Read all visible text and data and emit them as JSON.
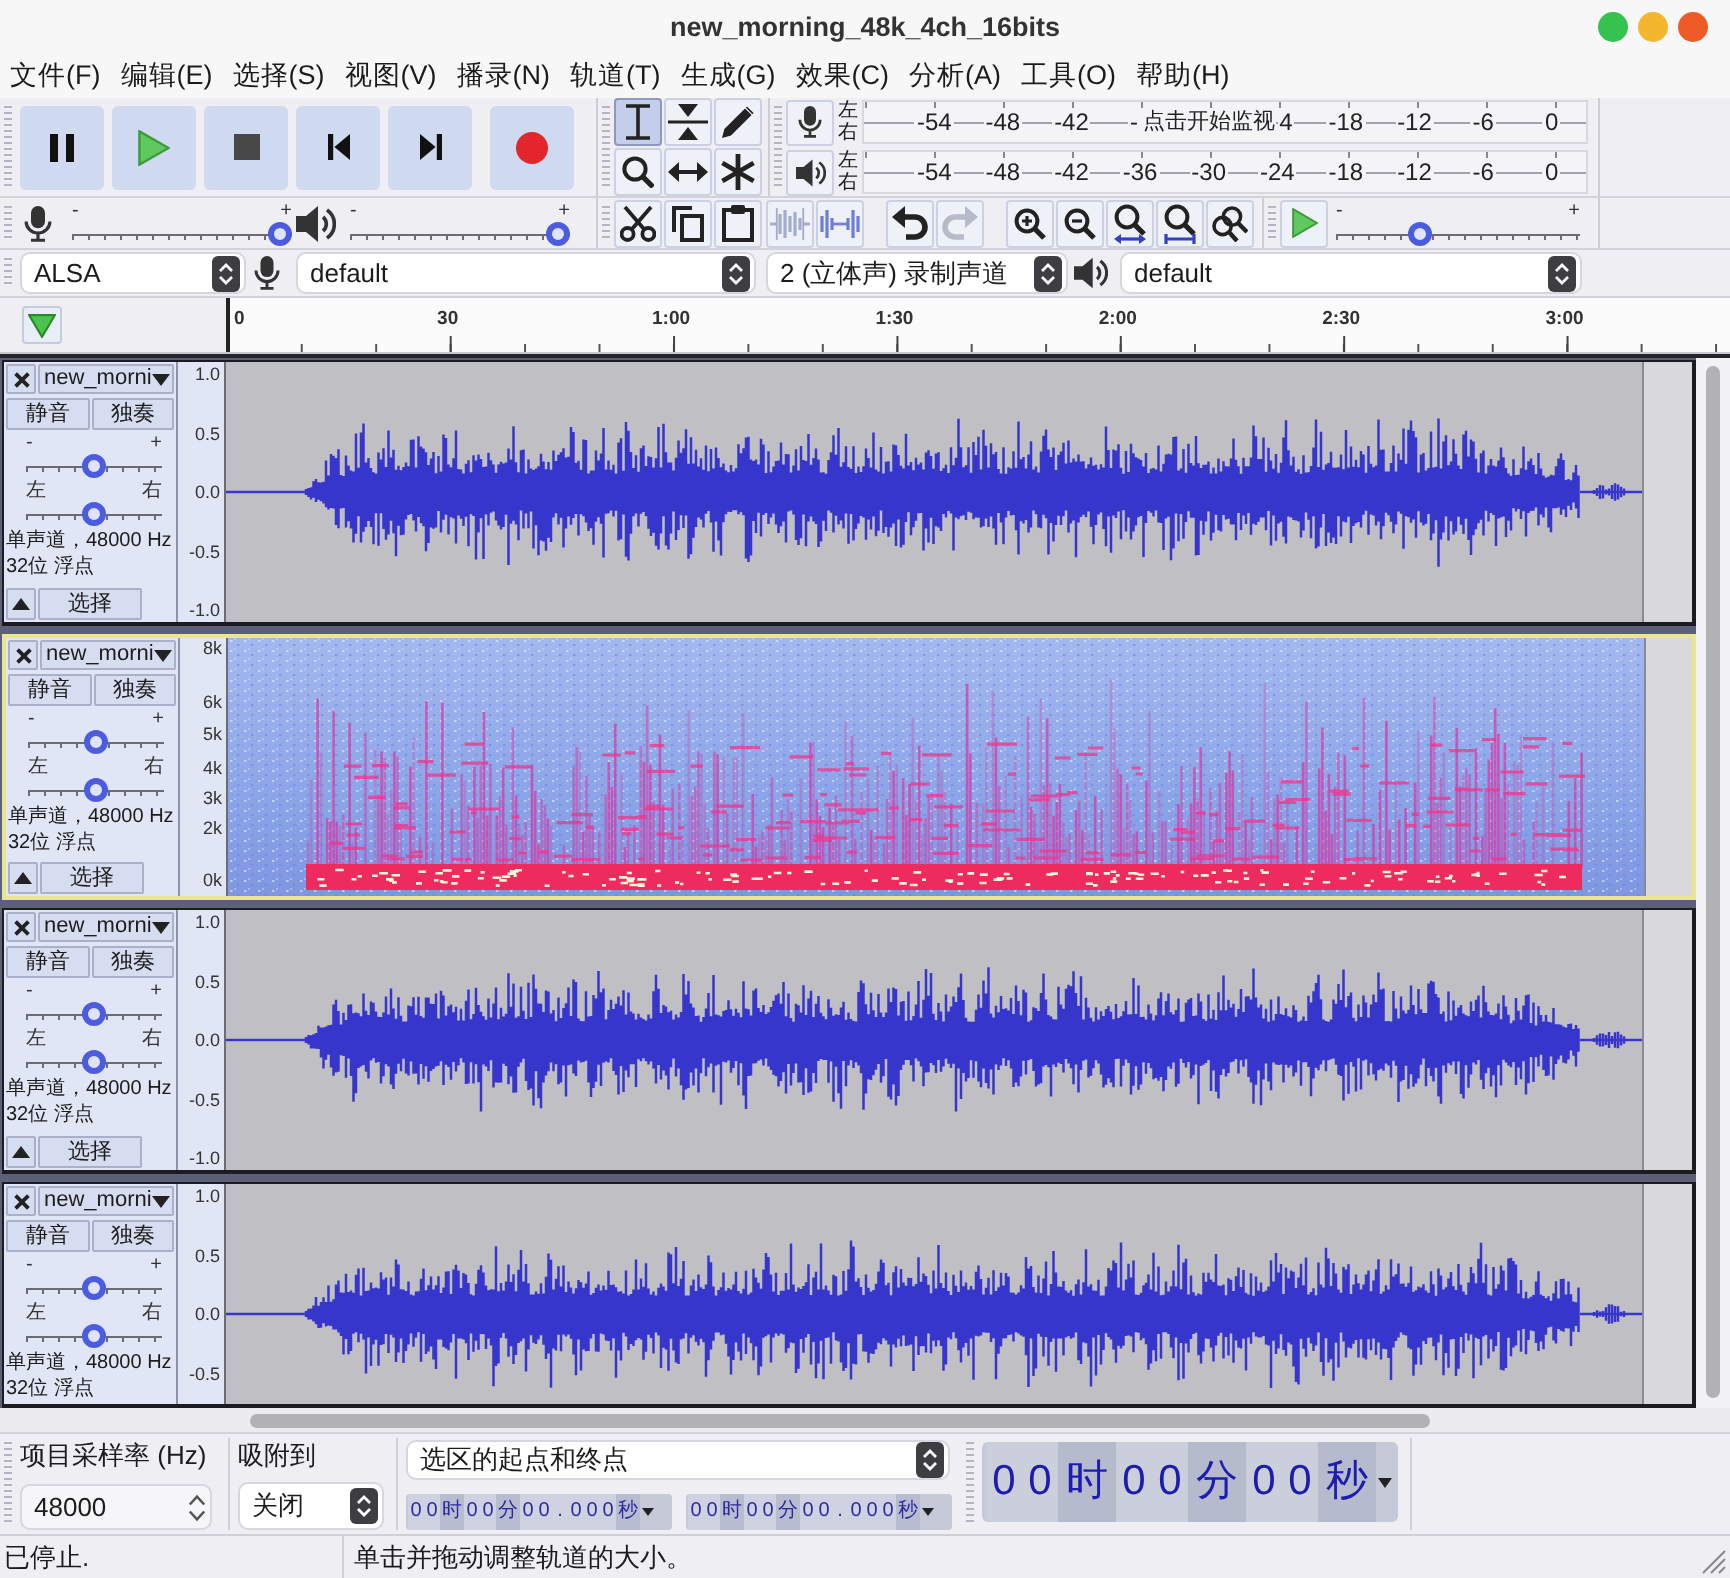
{
  "window": {
    "title": "new_morning_48k_4ch_16bits"
  },
  "menu": [
    "文件(F)",
    "编辑(E)",
    "选择(S)",
    "视图(V)",
    "播录(N)",
    "轨道(T)",
    "生成(G)",
    "效果(C)",
    "分析(A)",
    "工具(O)",
    "帮助(H)"
  ],
  "tools": [
    {
      "selected": true
    },
    {
      "selected": false
    },
    {
      "selected": false
    },
    {
      "selected": false
    },
    {
      "selected": false
    },
    {
      "selected": false
    }
  ],
  "meters": [
    {
      "kind": "recording",
      "channels": [
        "左",
        "右"
      ],
      "scale": [
        {
          "kind": "tick",
          "text": "-54"
        },
        {
          "kind": "tick",
          "text": "-48"
        },
        {
          "kind": "tick",
          "text": "-42"
        },
        {
          "kind": "tick",
          "text": "-"
        },
        {
          "kind": "hint",
          "text": "点击开始监视"
        },
        {
          "kind": "tick",
          "text": "4"
        },
        {
          "kind": "tick",
          "text": "-18"
        },
        {
          "kind": "tick",
          "text": "-12"
        },
        {
          "kind": "tick",
          "text": "-6"
        },
        {
          "kind": "tick",
          "text": "0"
        }
      ]
    },
    {
      "kind": "playback",
      "channels": [
        "左",
        "右"
      ],
      "scale": [
        {
          "kind": "tick",
          "text": "-54"
        },
        {
          "kind": "tick",
          "text": "-48"
        },
        {
          "kind": "tick",
          "text": "-42"
        },
        {
          "kind": "tick",
          "text": "-36"
        },
        {
          "kind": "tick",
          "text": "-30"
        },
        {
          "kind": "tick",
          "text": "-24"
        },
        {
          "kind": "tick",
          "text": "-18"
        },
        {
          "kind": "tick",
          "text": "-12"
        },
        {
          "kind": "tick",
          "text": "-6"
        },
        {
          "kind": "tick",
          "text": "0"
        }
      ]
    }
  ],
  "mixer": [
    {
      "kind": "recording",
      "low_label": "-",
      "high_label": "+",
      "level": 1
    },
    {
      "kind": "playback",
      "low_label": "-",
      "high_label": "+",
      "level": 1
    }
  ],
  "edit": [
    {
      "disabled": false
    },
    {
      "disabled": false
    },
    {
      "disabled": false
    },
    {
      "disabled": true
    },
    {
      "disabled": true
    }
  ],
  "history": [
    {
      "disabled": false
    },
    {
      "disabled": true
    }
  ],
  "play_at_speed": {
    "low_label": "-",
    "high_label": "+",
    "level": 0.33
  },
  "devices": {
    "host": "ALSA",
    "recording_device": "default",
    "recording_channels": "2 (立体声) 录制声道",
    "playback_device": "default"
  },
  "timeline": {
    "labels": [
      "0",
      "30",
      "1:00",
      "1:30",
      "2:00",
      "2:30",
      "3:00"
    ]
  },
  "tracks": [
    {
      "kind": "waveform",
      "focused": false,
      "name": "new_morni",
      "mute": "静音",
      "solo": "独奏",
      "gain": {
        "low_label": "-",
        "high_label": "+",
        "level": 0.5
      },
      "pan": {
        "low_label": "左",
        "high_label": "右",
        "level": 0.5
      },
      "info": [
        "单声道，48000 Hz",
        "32位 浮点"
      ],
      "select": "选择",
      "ruler": [
        "1.0",
        "0.5",
        "0.0",
        "-0.5",
        "-1.0"
      ]
    },
    {
      "kind": "spectrogram",
      "focused": true,
      "name": "new_morni",
      "mute": "静音",
      "solo": "独奏",
      "gain": {
        "low_label": "-",
        "high_label": "+",
        "level": 0.5
      },
      "pan": {
        "low_label": "左",
        "high_label": "右",
        "level": 0.5
      },
      "info": [
        "单声道，48000 Hz",
        "32位 浮点"
      ],
      "select": "选择",
      "ruler": [
        "8k",
        "6k",
        "5k",
        "4k",
        "3k",
        "2k",
        "0k"
      ]
    },
    {
      "kind": "waveform",
      "focused": false,
      "name": "new_morni",
      "mute": "静音",
      "solo": "独奏",
      "gain": {
        "low_label": "-",
        "high_label": "+",
        "level": 0.5
      },
      "pan": {
        "low_label": "左",
        "high_label": "右",
        "level": 0.5
      },
      "info": [
        "单声道，48000 Hz",
        "32位 浮点"
      ],
      "select": "选择",
      "ruler": [
        "1.0",
        "0.5",
        "0.0",
        "-0.5",
        "-1.0"
      ]
    },
    {
      "kind": "waveform",
      "focused": false,
      "name": "new_morni",
      "mute": "静音",
      "solo": "独奏",
      "gain": {
        "low_label": "-",
        "high_label": "+",
        "level": 0.5
      },
      "pan": {
        "low_label": "左",
        "high_label": "右",
        "level": 0.5
      },
      "info": [
        "单声道，48000 Hz",
        "32位 浮点"
      ],
      "ruler": [
        "1.0",
        "0.5",
        "0.0",
        "-0.5"
      ]
    }
  ],
  "selection_bar": {
    "rate_label": "项目采样率 (Hz)",
    "rate": "48000",
    "snap_label": "吸附到",
    "snap": "关闭",
    "mode": "选区的起点和终点",
    "start": {
      "fields": [
        {
          "digits": [
            "0",
            "0"
          ],
          "unit": "时"
        },
        {
          "digits": [
            "0",
            "0"
          ],
          "unit": "分"
        },
        {
          "digits": [
            "0",
            "0",
            ".",
            "0",
            "0",
            "0"
          ],
          "unit": "秒"
        }
      ]
    },
    "end": {
      "fields": [
        {
          "digits": [
            "0",
            "0"
          ],
          "unit": "时"
        },
        {
          "digits": [
            "0",
            "0"
          ],
          "unit": "分"
        },
        {
          "digits": [
            "0",
            "0",
            ".",
            "0",
            "0",
            "0"
          ],
          "unit": "秒"
        }
      ]
    }
  },
  "time": {
    "fields": [
      {
        "digits": [
          "0",
          "0"
        ],
        "unit": "时"
      },
      {
        "digits": [
          "0",
          "0"
        ],
        "unit": "分"
      },
      {
        "digits": [
          "0",
          "0"
        ],
        "unit": "秒"
      }
    ]
  },
  "status_bar": {
    "state": "已停止.",
    "hint": "单击并拖动调整轨道的大小。"
  }
}
